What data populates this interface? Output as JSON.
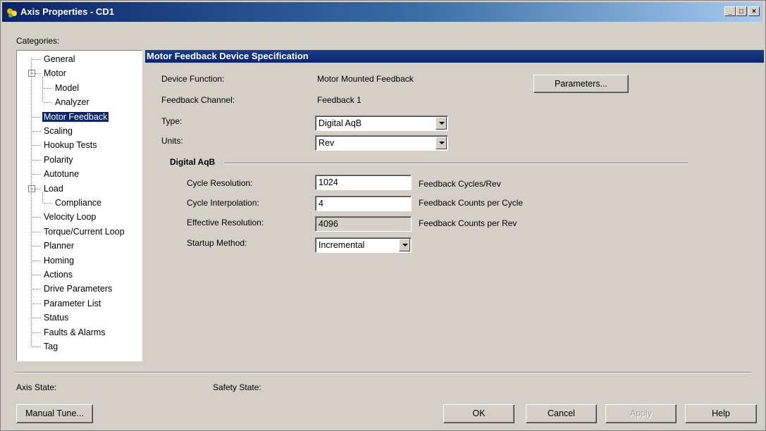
{
  "window": {
    "title": "Axis Properties - CD1",
    "controls": [
      "_",
      "□",
      "×"
    ]
  },
  "categories_label": "Categories:",
  "tree": [
    {
      "label": "General",
      "depth": 0
    },
    {
      "label": "Motor",
      "depth": 0,
      "expander": "−"
    },
    {
      "label": "Model",
      "depth": 1
    },
    {
      "label": "Analyzer",
      "depth": 1
    },
    {
      "label": "Motor Feedback",
      "depth": 0,
      "selected": true
    },
    {
      "label": "Scaling",
      "depth": 0
    },
    {
      "label": "Hookup Tests",
      "depth": 0
    },
    {
      "label": "Polarity",
      "depth": 0
    },
    {
      "label": "Autotune",
      "depth": 0
    },
    {
      "label": "Load",
      "depth": 0,
      "expander": "−"
    },
    {
      "label": "Compliance",
      "depth": 1
    },
    {
      "label": "Velocity Loop",
      "depth": 0
    },
    {
      "label": "Torque/Current Loop",
      "depth": 0
    },
    {
      "label": "Planner",
      "depth": 0
    },
    {
      "label": "Homing",
      "depth": 0
    },
    {
      "label": "Actions",
      "depth": 0
    },
    {
      "label": "Drive Parameters",
      "depth": 0
    },
    {
      "label": "Parameter List",
      "depth": 0
    },
    {
      "label": "Status",
      "depth": 0
    },
    {
      "label": "Faults & Alarms",
      "depth": 0
    },
    {
      "label": "Tag",
      "depth": 0
    }
  ],
  "section": {
    "title": "Motor Feedback Device Specification",
    "device_function_label": "Device Function:",
    "device_function_value": "Motor Mounted Feedback",
    "feedback_channel_label": "Feedback Channel:",
    "feedback_channel_value": "Feedback 1",
    "type_label": "Type:",
    "type_value": "Digital AqB",
    "units_label": "Units:",
    "units_value": "Rev",
    "parameters_button": "Parameters..."
  },
  "digital": {
    "group_title": "Digital AqB",
    "cycle_resolution_label": "Cycle Resolution:",
    "cycle_resolution_value": "1024",
    "cycle_resolution_unit": "Feedback Cycles/Rev",
    "cycle_interpolation_label": "Cycle Interpolation:",
    "cycle_interpolation_value": "4",
    "cycle_interpolation_unit": "Feedback Counts per Cycle",
    "effective_resolution_label": "Effective Resolution:",
    "effective_resolution_value": "4096",
    "effective_resolution_unit": "Feedback Counts per Rev",
    "startup_method_label": "Startup Method:",
    "startup_method_value": "Incremental"
  },
  "footer": {
    "axis_state_label": "Axis State:",
    "safety_state_label": "Safety State:",
    "manual_tune": "Manual Tune...",
    "ok": "OK",
    "cancel": "Cancel",
    "apply": "Apply",
    "help": "Help"
  },
  "colors": {
    "title_bar": "#0a246a",
    "selection": "#0a246a",
    "face": "#d4d0c8"
  }
}
